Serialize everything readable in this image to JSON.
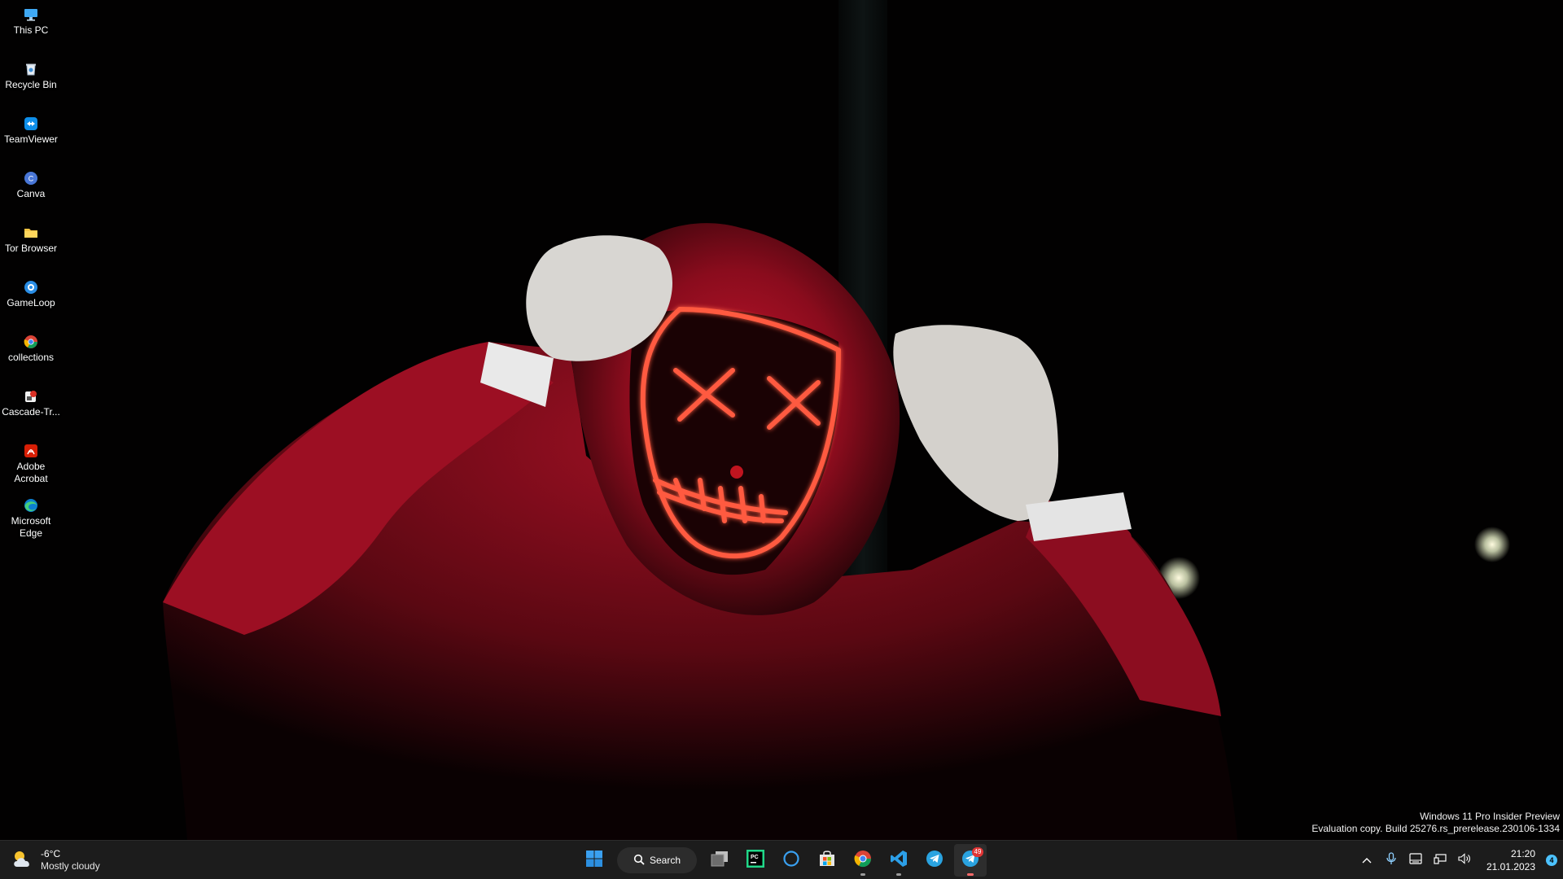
{
  "desktop": {
    "icons": [
      {
        "label": "This PC",
        "icon": "computer-icon"
      },
      {
        "label": "Recycle Bin",
        "icon": "recycle-bin-icon"
      },
      {
        "label": "TeamViewer",
        "icon": "teamviewer-icon"
      },
      {
        "label": "Canva",
        "icon": "canva-icon"
      },
      {
        "label": "Tor Browser",
        "icon": "folder-icon"
      },
      {
        "label": "GameLoop",
        "icon": "gameloop-icon"
      },
      {
        "label": "collections",
        "icon": "chrome-icon"
      },
      {
        "label": "Cascade-Tr...",
        "icon": "cascade-icon"
      },
      {
        "label": "Adobe Acrobat",
        "icon": "acrobat-icon"
      },
      {
        "label": "Microsoft Edge",
        "icon": "edge-icon"
      }
    ]
  },
  "watermark": {
    "line1": "Windows 11 Pro Insider Preview",
    "line2": "Evaluation copy. Build 25276.rs_prerelease.230106-1334"
  },
  "taskbar": {
    "weather": {
      "temp": "-6°C",
      "condition": "Mostly cloudy",
      "icon": "partly-cloudy-icon"
    },
    "search_label": "Search",
    "apps": [
      {
        "name": "start",
        "icon": "windows-start-icon"
      },
      {
        "name": "task-view",
        "icon": "task-view-icon"
      },
      {
        "name": "pycharm",
        "icon": "pycharm-icon"
      },
      {
        "name": "cortana",
        "icon": "cortana-icon"
      },
      {
        "name": "microsoft-store",
        "icon": "store-icon"
      },
      {
        "name": "chrome",
        "icon": "chrome-icon"
      },
      {
        "name": "vscode",
        "icon": "vscode-icon"
      },
      {
        "name": "telegram",
        "icon": "telegram-icon"
      },
      {
        "name": "telegram-active",
        "icon": "telegram-icon",
        "badge": "49"
      }
    ],
    "clock": {
      "time": "21:20",
      "date": "21.01.2023"
    },
    "notifications": "4"
  },
  "colors": {
    "taskbar_bg": "#1c1c1c",
    "accent": "#4cc2ff",
    "hoodie_red": "#b0122a",
    "mask_glow": "#ff4a3a"
  }
}
